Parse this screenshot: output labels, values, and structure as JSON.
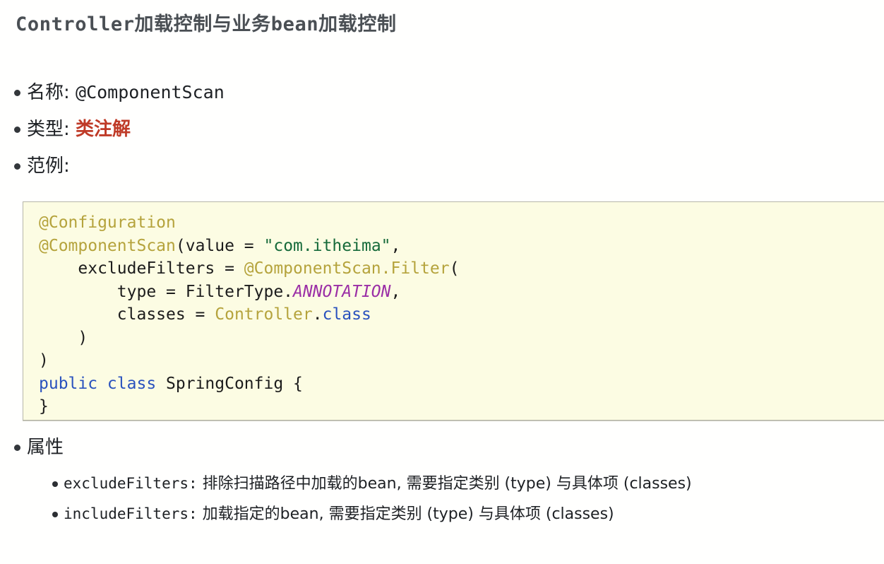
{
  "page": {
    "background": "#fffffe",
    "title": "Controller加载控制与业务bean加载控制",
    "title_color": "#4a4f54"
  },
  "bullets": [
    {
      "label": "名称:",
      "value": "@ComponentScan",
      "value_style": "mono"
    },
    {
      "label": "类型:",
      "value": "类注解",
      "value_style": "accent-red",
      "accent_color": "#bf3a27"
    },
    {
      "label": "范例:",
      "value": "",
      "value_style": "none"
    }
  ],
  "code_block": {
    "background": "#fcfce3",
    "border_color": "#b6b6a8",
    "token_colors": {
      "annotation": "#b5a33c",
      "string": "#166a3a",
      "enum_constant": "#9b2fa6",
      "keyword": "#2a52be",
      "field": "#2a52be",
      "plain": "#1c1c1c"
    },
    "lines": [
      [
        {
          "t": "@Configuration",
          "c": "anno"
        }
      ],
      [
        {
          "t": "@ComponentScan",
          "c": "anno"
        },
        {
          "t": "(value = ",
          "c": "plain"
        },
        {
          "t": "\"com.itheima\"",
          "c": "str"
        },
        {
          "t": ",",
          "c": "plain"
        }
      ],
      [
        {
          "t": "    excludeFilters = ",
          "c": "plain"
        },
        {
          "t": "@ComponentScan.Filter",
          "c": "anno"
        },
        {
          "t": "(",
          "c": "plain"
        }
      ],
      [
        {
          "t": "        type = FilterType.",
          "c": "plain"
        },
        {
          "t": "ANNOTATION",
          "c": "enum"
        },
        {
          "t": ",",
          "c": "plain"
        }
      ],
      [
        {
          "t": "        classes = ",
          "c": "plain"
        },
        {
          "t": "Controller",
          "c": "anno"
        },
        {
          "t": ".",
          "c": "plain"
        },
        {
          "t": "class",
          "c": "field"
        }
      ],
      [
        {
          "t": "    )",
          "c": "plain"
        }
      ],
      [
        {
          "t": ")",
          "c": "plain"
        }
      ],
      [
        {
          "t": "public class",
          "c": "kw"
        },
        {
          "t": " SpringConfig {",
          "c": "plain"
        }
      ],
      [
        {
          "t": "}",
          "c": "plain"
        }
      ]
    ],
    "plain_text": "@Configuration\n@ComponentScan(value = \"com.itheima\",\n    excludeFilters = @ComponentScan.Filter(\n        type = FilterType.ANNOTATION,\n        classes = Controller.class\n    )\n)\npublic class SpringConfig {\n}"
  },
  "attributes": {
    "heading": "属性",
    "items": [
      {
        "name": "excludeFilters:",
        "description": "排除扫描路径中加载的bean, 需要指定类别 (type) 与具体项 (classes)"
      },
      {
        "name": "includeFilters:",
        "description": "加载指定的bean, 需要指定类别 (type) 与具体项 (classes)"
      }
    ]
  }
}
